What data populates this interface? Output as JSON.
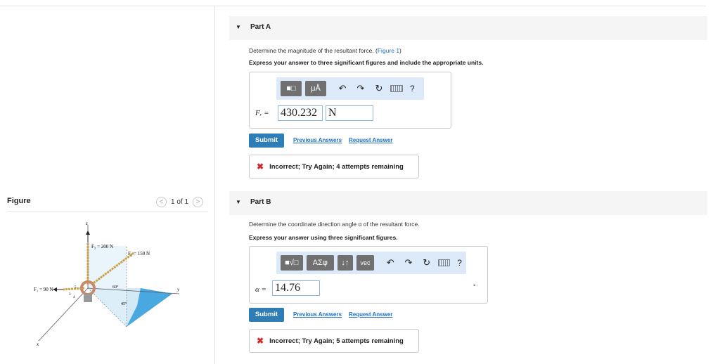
{
  "figure": {
    "title": "Figure",
    "pager": {
      "prev": "<",
      "text": "1 of 1",
      "next": ">"
    },
    "labels": {
      "z": "z",
      "y": "y",
      "x": "x",
      "f3": "F₃ = 200 N",
      "f2": "F₂ = 150 N",
      "f1": "F₁ = 90 N",
      "angle60": "60°",
      "angle45": "45°",
      "ratio3": "3",
      "ratio4": "4",
      "ratio5": "5"
    }
  },
  "partA": {
    "title": "Part A",
    "question_text": "Determine the magnitude of the resultant force. (",
    "figure_link": "Figure 1",
    "question_end": ")",
    "instruction": "Express your answer to three significant figures and include the appropriate units.",
    "toolbar": {
      "templates": "■□",
      "units": "μÅ",
      "undo": "↶",
      "redo": "↷",
      "reset": "↻",
      "help": "?"
    },
    "var_label": "Fᵣ =",
    "value": "430.232",
    "unit": "N",
    "submit": "Submit",
    "prev_answers": "Previous Answers",
    "request_answer": "Request Answer",
    "feedback_icon": "✖",
    "feedback": "Incorrect; Try Again; 4 attempts remaining"
  },
  "partB": {
    "title": "Part B",
    "question_text": "Determine the coordinate direction angle α of the resultant force.",
    "instruction": "Express your answer using three significant figures.",
    "toolbar": {
      "templates": "■√□",
      "symbols": "ΑΣφ",
      "arrows": "↓↑",
      "vec": "vec",
      "undo": "↶",
      "redo": "↷",
      "reset": "↻",
      "help": "?"
    },
    "var_label": "α =",
    "value": "14.76",
    "degree": "°",
    "submit": "Submit",
    "prev_answers": "Previous Answers",
    "request_answer": "Request Answer",
    "feedback_icon": "✖",
    "feedback": "Incorrect; Try Again; 5 attempts remaining"
  }
}
